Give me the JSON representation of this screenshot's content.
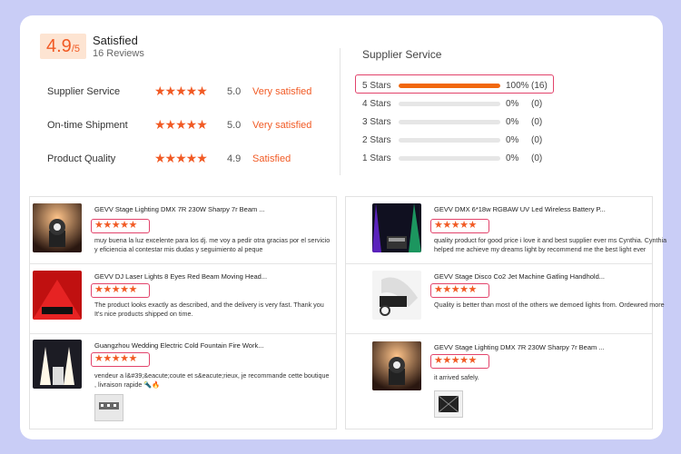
{
  "overall": {
    "score": "4.9",
    "denominator": "/5",
    "label": "Satisfied",
    "review_count": "16 Reviews"
  },
  "metrics": [
    {
      "name": "Supplier Service",
      "stars": 5,
      "value": "5.0",
      "desc": "Very satisfied"
    },
    {
      "name": "On-time Shipment",
      "stars": 5,
      "value": "5.0",
      "desc": "Very satisfied"
    },
    {
      "name": "Product Quality",
      "stars": 5,
      "value": "4.9",
      "desc": "Satisfied"
    }
  ],
  "supplier_service": {
    "title": "Supplier Service",
    "distribution": [
      {
        "label": "5 Stars",
        "fraction": 1.0,
        "pct": "100%",
        "count": "(16)"
      },
      {
        "label": "4 Stars",
        "fraction": 0.0,
        "pct": "0%",
        "count": "(0)"
      },
      {
        "label": "3 Stars",
        "fraction": 0.0,
        "pct": "0%",
        "count": "(0)"
      },
      {
        "label": "2 Stars",
        "fraction": 0.0,
        "pct": "0%",
        "count": "(0)"
      },
      {
        "label": "1 Stars",
        "fraction": 0.0,
        "pct": "0%",
        "count": "(0)"
      }
    ]
  },
  "reviews": [
    {
      "title": "GEVV Stage Lighting DMX 7R 230W Sharpy 7r Beam ...",
      "stars": 5,
      "text": "muy buena la luz excelente para los dj. me voy a pedir otra gracias por el servicio y eficiencia al contestar mis dudas y seguimiento al peque",
      "thumb": "moving-head"
    },
    {
      "title": "GEVV DJ Laser Lights 8 Eyes Red Beam Moving Head...",
      "stars": 5,
      "text": "The product looks exactly as described, and the delivery is very fast. Thank you It's nice products shipped on time.",
      "thumb": "laser"
    },
    {
      "title": "Guangzhou Wedding Electric Cold Fountain Fire Work...",
      "stars": 5,
      "text": "vendeur a l&#39;&eacute;coute et s&eacute;rieux, je recommande cette boutique , livraison rapide 🔦🔥",
      "thumb": "fountain"
    },
    {
      "title": "GEVV DMX 6*18w RGBAW UV Led Wireless Battery P...",
      "stars": 5,
      "text": "quality product for good price i love it and best supplier ever ms Cynthia. Cynthia helped me achieve my dreams light by recommend me the best light ever",
      "thumb": "uplight"
    },
    {
      "title": "GEVV Stage Disco Co2 Jet Machine Gatling Handhold...",
      "stars": 5,
      "text": "Quality is better than most of the others we demoed lights from.  Ordewred more",
      "thumb": "co2"
    },
    {
      "title": "GEVV Stage Lighting DMX 7R 230W Sharpy 7r Beam ...",
      "stars": 5,
      "text": "it arrived safely.",
      "thumb": "moving-head"
    }
  ],
  "colors": {
    "accent": "#f15a24",
    "highlight_border": "#e2436b",
    "background": "#c9cdf6"
  },
  "icons": {
    "star": "star-icon"
  }
}
